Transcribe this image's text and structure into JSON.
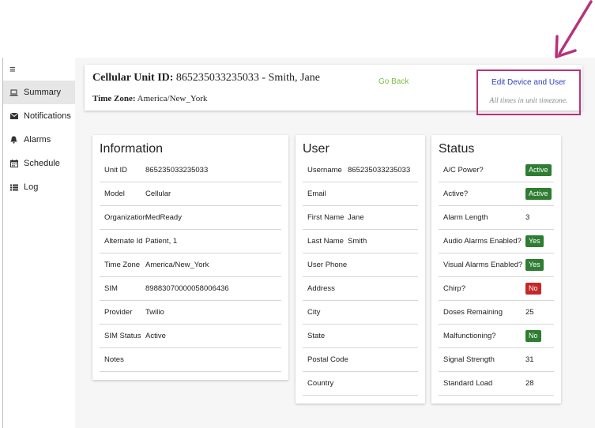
{
  "sidebar": {
    "menu_icon": "menu-icon",
    "items": [
      {
        "label": "Summary",
        "icon": "laptop-icon",
        "active": true
      },
      {
        "label": "Notifications",
        "icon": "envelope-icon",
        "active": false
      },
      {
        "label": "Alarms",
        "icon": "bell-icon",
        "active": false
      },
      {
        "label": "Schedule",
        "icon": "calendar-icon",
        "active": false
      },
      {
        "label": "Log",
        "icon": "list-icon",
        "active": false
      }
    ]
  },
  "header": {
    "unit_label": "Cellular Unit ID:",
    "unit_value": "865235033235033 - Smith, Jane",
    "tz_label": "Time Zone:",
    "tz_value": "America/New_York",
    "go_back": "Go Back",
    "edit_link": "Edit Device and User",
    "tz_note": "All times in unit timezone."
  },
  "information": {
    "title": "Information",
    "rows": [
      {
        "label": "Unit ID",
        "value": "865235033235033"
      },
      {
        "label": "Model",
        "value": "Cellular"
      },
      {
        "label": "Organization",
        "value": "MedReady"
      },
      {
        "label": "Alternate Id",
        "value": "Patient, 1"
      },
      {
        "label": "Time Zone",
        "value": "America/New_York"
      },
      {
        "label": "SIM",
        "value": "89883070000058006436"
      },
      {
        "label": "Provider",
        "value": "Twilio"
      },
      {
        "label": "SIM Status",
        "value": "Active"
      },
      {
        "label": "Notes",
        "value": ""
      }
    ]
  },
  "user": {
    "title": "User",
    "rows": [
      {
        "label": "Username",
        "value": "865235033235033"
      },
      {
        "label": "Email",
        "value": ""
      },
      {
        "label": "First Name",
        "value": "Jane"
      },
      {
        "label": "Last Name",
        "value": "Smith"
      },
      {
        "label": "User Phone",
        "value": ""
      },
      {
        "label": "Address",
        "value": ""
      },
      {
        "label": "City",
        "value": ""
      },
      {
        "label": "State",
        "value": ""
      },
      {
        "label": "Postal Code",
        "value": ""
      },
      {
        "label": "Country",
        "value": ""
      }
    ]
  },
  "status": {
    "title": "Status",
    "rows": [
      {
        "label": "A/C Power?",
        "value": "Active",
        "badge": "green"
      },
      {
        "label": "Active?",
        "value": "Active",
        "badge": "green"
      },
      {
        "label": "Alarm Length",
        "value": "3",
        "badge": null
      },
      {
        "label": "Audio Alarms Enabled?",
        "value": "Yes",
        "badge": "green"
      },
      {
        "label": "Visual Alarms Enabled?",
        "value": "Yes",
        "badge": "green"
      },
      {
        "label": "Chirp?",
        "value": "No",
        "badge": "red"
      },
      {
        "label": "Doses Remaining",
        "value": "25",
        "badge": null
      },
      {
        "label": "Malfunctioning?",
        "value": "No",
        "badge": "green"
      },
      {
        "label": "Signal Strength",
        "value": "31",
        "badge": null
      },
      {
        "label": "Standard Load",
        "value": "28",
        "badge": null
      }
    ]
  },
  "colors": {
    "badge_green": "#2e7d32",
    "badge_red": "#c62828",
    "go_back": "#7bc043",
    "link": "#2f3fbf",
    "highlight": "#b8327a"
  }
}
